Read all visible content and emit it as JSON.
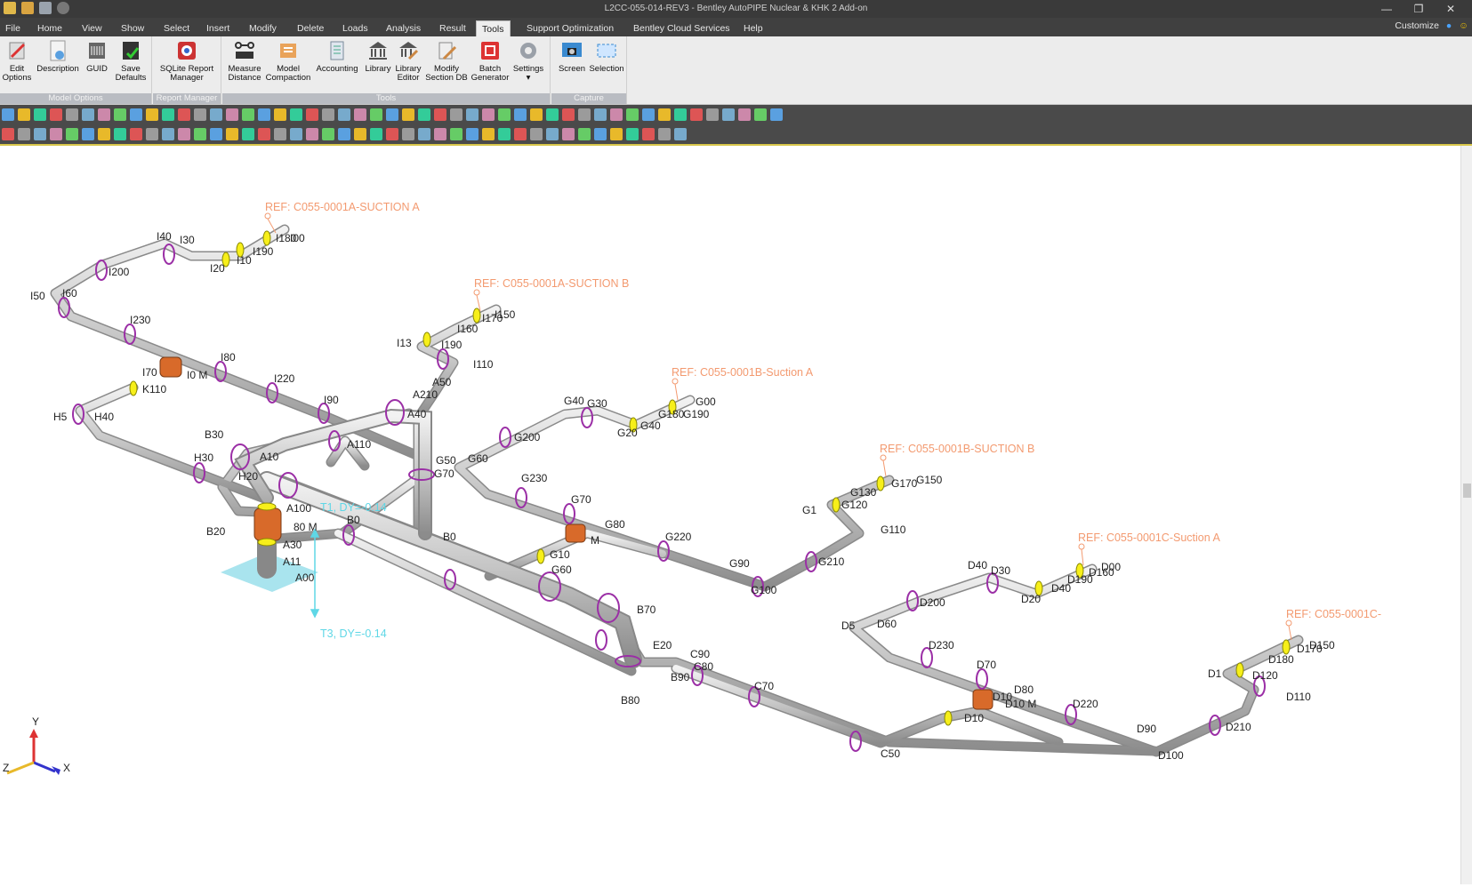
{
  "window": {
    "title": "L2CC-055-014-REV3 - Bentley AutoPIPE Nuclear & KHK 2 Add-on"
  },
  "menu": {
    "tabs": [
      "File",
      "Home",
      "View",
      "Show",
      "Select",
      "Insert",
      "Modify",
      "Delete",
      "Loads",
      "Analysis",
      "Result",
      "Tools",
      "Support Optimization",
      "Bentley Cloud Services",
      "Help"
    ],
    "active": "Tools",
    "customize": "Customize"
  },
  "ribbon": {
    "groups": {
      "model_options": "Model Options",
      "report_manager": "Report Manager",
      "tools": "Tools",
      "capture": "Capture"
    },
    "buttons": {
      "edit_options": [
        "Edit",
        "Options"
      ],
      "description": [
        "Description",
        ""
      ],
      "guid": [
        "GUID",
        ""
      ],
      "save_defaults": [
        "Save",
        "Defaults"
      ],
      "sqlite": [
        "SQLite Report",
        "Manager"
      ],
      "measure": [
        "Measure",
        "Distance"
      ],
      "compaction": [
        "Model",
        "Compaction"
      ],
      "accounting": [
        "Accounting",
        ""
      ],
      "library": [
        "Library",
        ""
      ],
      "library_editor": [
        "Library",
        "Editor"
      ],
      "modify_section": [
        "Modify",
        "Section DB"
      ],
      "batch": [
        "Batch",
        "Generator"
      ],
      "settings": [
        "Settings",
        "▾"
      ],
      "screen": [
        "Screen",
        ""
      ],
      "selection": [
        "Selection",
        ""
      ]
    }
  },
  "model": {
    "refs": [
      "REF: C055-0001A-SUCTION A",
      "REF: C055-0001A-SUCTION B",
      "REF: C055-0001B-Suction A",
      "REF: C055-0001B-SUCTION B",
      "REF: C055-0001C-Suction A",
      "REF: C055-0001C-"
    ],
    "loads": [
      "T3, DY=-0.14",
      "T1, DY=-0.14"
    ],
    "axes": {
      "y": "Y",
      "x": "X",
      "z": "Z"
    }
  }
}
